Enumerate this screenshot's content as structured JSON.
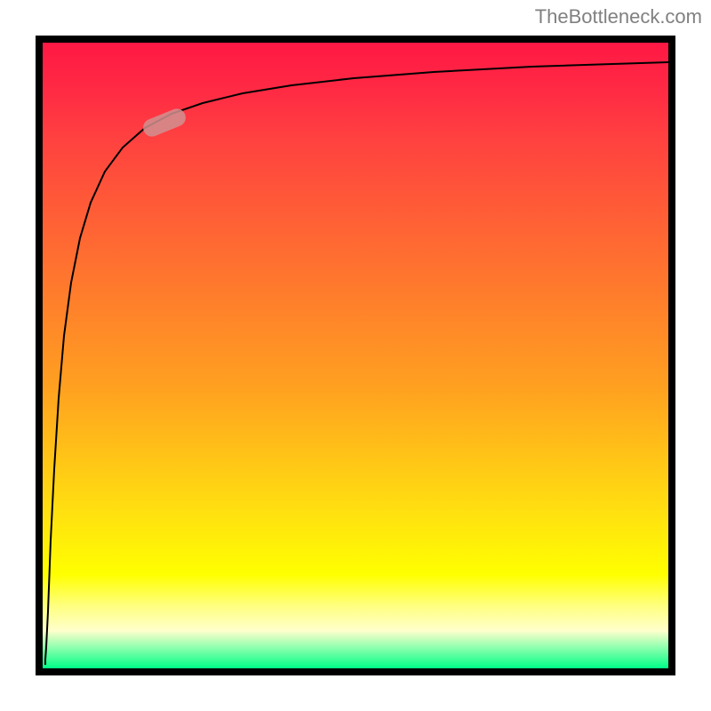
{
  "watermark": "TheBottleneck.com",
  "chart_data": {
    "type": "line",
    "title": "",
    "xlabel": "",
    "ylabel": "",
    "x": [
      0.5,
      1,
      2,
      3,
      5,
      8,
      12,
      18,
      25,
      35,
      50,
      70,
      100,
      150,
      250,
      400,
      700
    ],
    "y": [
      0,
      5,
      25,
      45,
      60,
      72,
      78,
      82,
      85,
      87,
      89,
      90.5,
      91.5,
      92.5,
      93.5,
      94,
      95
    ],
    "xlim": [
      0,
      700
    ],
    "ylim": [
      0,
      100
    ],
    "curve_description": "Steep logarithmic growth curve rising rapidly from origin and flattening near top",
    "marker": {
      "x_approx": 18,
      "y_approx": 82,
      "color": "#d19090"
    },
    "background_gradient": {
      "orientation": "vertical",
      "stops": [
        {
          "pos": 0,
          "color": "#ff1844"
        },
        {
          "pos": 0.5,
          "color": "#ff9028"
        },
        {
          "pos": 0.85,
          "color": "#ffff00"
        },
        {
          "pos": 1.0,
          "color": "#00ff88"
        }
      ]
    }
  }
}
